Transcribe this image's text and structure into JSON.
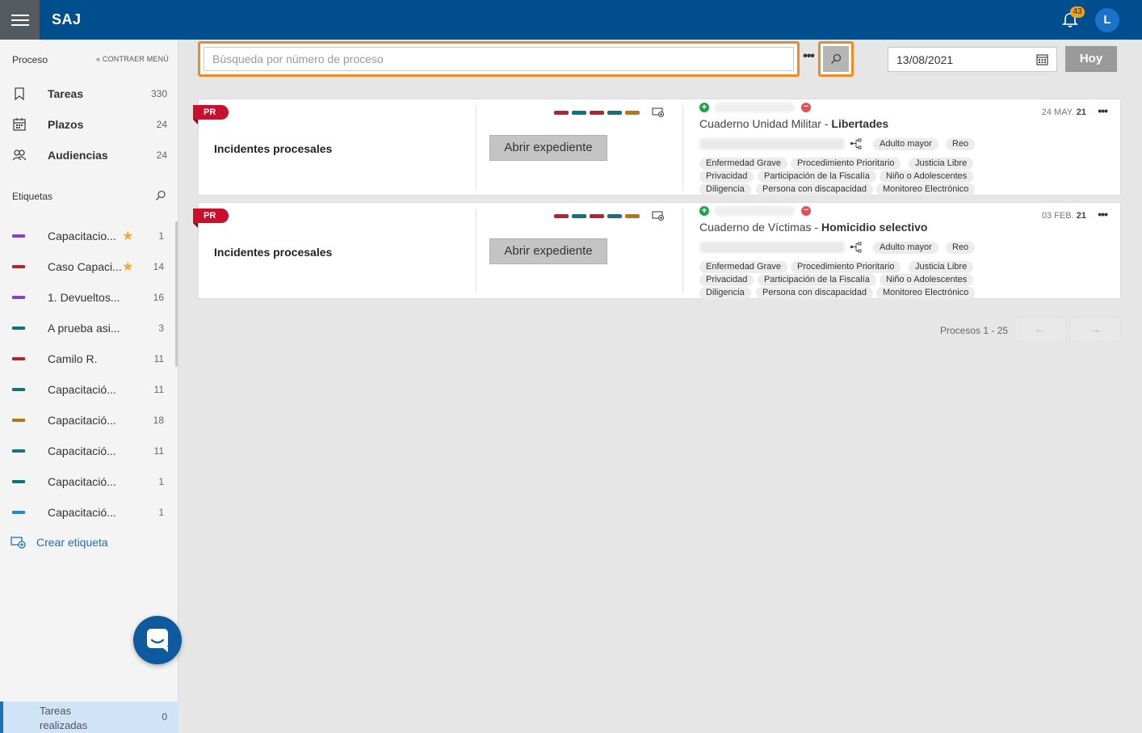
{
  "header": {
    "brand": "SAJ",
    "notifications": "43",
    "avatar_initial": "L"
  },
  "sidebar": {
    "section_title": "Proceso",
    "collapse_label": "CONTRAER MENÚ",
    "nav": [
      {
        "label": "Tareas",
        "count": "330",
        "icon": "bookmark-icon"
      },
      {
        "label": "Plazos",
        "count": "24",
        "icon": "calendar-icon"
      },
      {
        "label": "Audiencias",
        "count": "24",
        "icon": "people-icon"
      }
    ],
    "tags_title": "Etiquetas",
    "tags": [
      {
        "label": "Capacitacio...",
        "count": "1",
        "color": "#8a3fd1",
        "starred": true
      },
      {
        "label": "Caso Capaci...",
        "count": "14",
        "color": "#b3252e",
        "starred": true
      },
      {
        "label": "1. Devueltos...",
        "count": "16",
        "color": "#8a3fd1",
        "starred": false
      },
      {
        "label": "A prueba asi...",
        "count": "3",
        "color": "#10747e",
        "starred": false
      },
      {
        "label": "Camilo R.",
        "count": "11",
        "color": "#b3252e",
        "starred": false
      },
      {
        "label": "Capacitació...",
        "count": "11",
        "color": "#10747e",
        "starred": false
      },
      {
        "label": "Capacitació...",
        "count": "18",
        "color": "#b07a12",
        "starred": false
      },
      {
        "label": "Capacitació...",
        "count": "11",
        "color": "#10747e",
        "starred": false
      },
      {
        "label": "Capacitació...",
        "count": "1",
        "color": "#10747e",
        "starred": false
      },
      {
        "label": "Capacitació...",
        "count": "1",
        "color": "#1a8ccf",
        "starred": false
      }
    ],
    "create_tag": "Crear etiqueta",
    "done": {
      "label": "Tareas realizadas",
      "count": "0"
    }
  },
  "search": {
    "placeholder": "Búsqueda por número de proceso",
    "more": "•••",
    "date": "13/08/2021",
    "today": "Hoy"
  },
  "cards": [
    {
      "badge": "PR",
      "title": "Incidentes procesales",
      "open_button": "Abrir expediente",
      "case_prefix": "Cuaderno Unidad Militar - ",
      "case_bold": "Libertades",
      "date_light": "24 MAY.",
      "date_bold": "21",
      "chips_top": [
        "Adulto mayor",
        "Reo"
      ],
      "chips_row1": [
        "Enfermedad Grave",
        "Procedimiento Prioritario",
        "Justicia Libre"
      ],
      "chips_row2": [
        "Privacidad",
        "Participación de la Fiscalía",
        "Niño o Adolescentes"
      ],
      "chips_row3": [
        "Diligencia",
        "Persona con discapacidad",
        "Monitoreo Electrónico"
      ]
    },
    {
      "badge": "PR",
      "title": "Incidentes procesales",
      "open_button": "Abrir expediente",
      "case_prefix": "Cuaderno de Víctimas - ",
      "case_bold": "Homicidio selectivo",
      "date_light": "03 FEB.",
      "date_bold": "21",
      "chips_top": [
        "Adulto mayor",
        "Reo"
      ],
      "chips_row1": [
        "Enfermedad Grave",
        "Procedimiento Prioritario",
        "Justicia Libre"
      ],
      "chips_row2": [
        "Privacidad",
        "Participación de la Fiscalía",
        "Niño o Adolescentes"
      ],
      "chips_row3": [
        "Diligencia",
        "Persona con discapacidad",
        "Monitoreo Electrónico"
      ]
    }
  ],
  "card_colors": [
    "#b3252e",
    "#10747e",
    "#b3252e",
    "#10747e",
    "#b07a12"
  ],
  "pagination": {
    "label": "Procesos 1 - 25",
    "prev": "←",
    "next": "→"
  }
}
